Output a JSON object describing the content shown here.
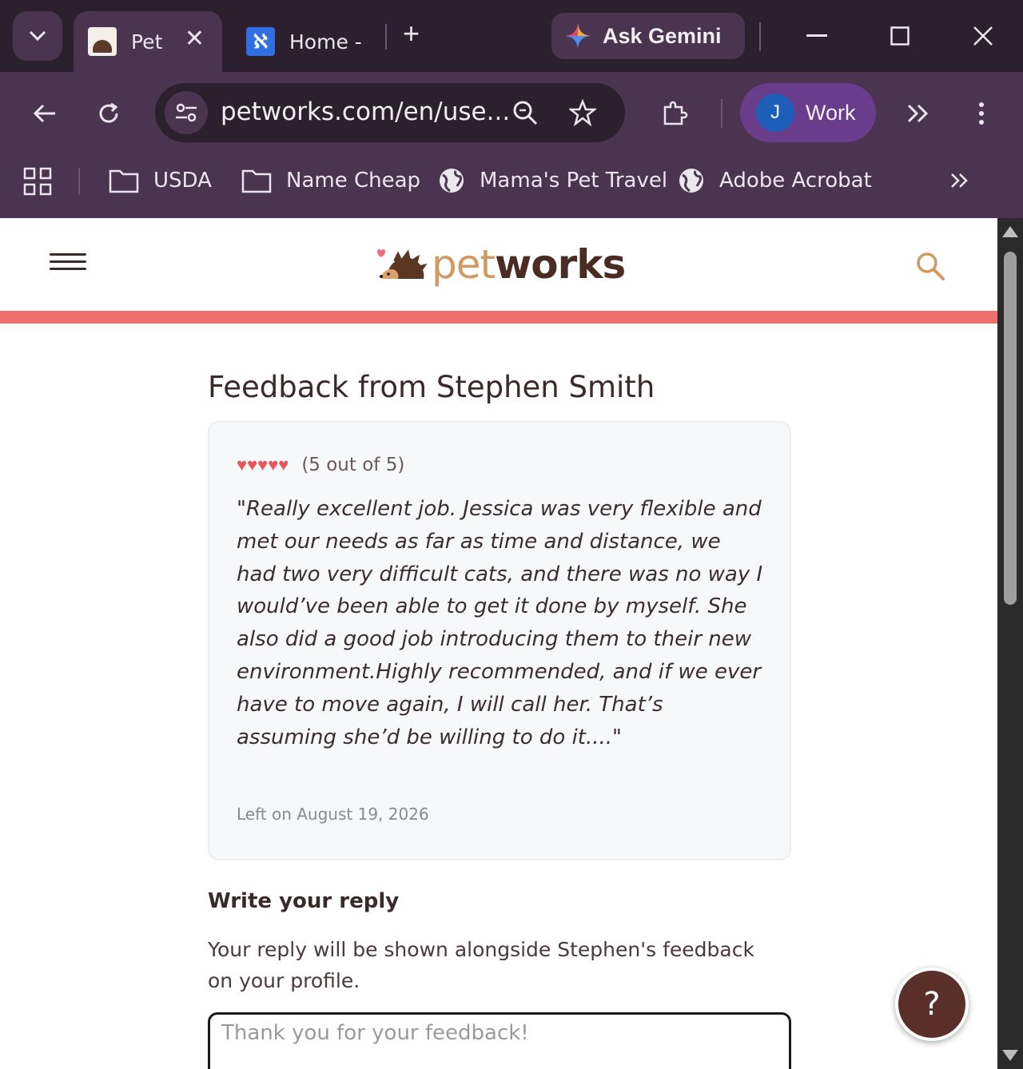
{
  "browser": {
    "tabs": [
      {
        "title": "Pet",
        "active": true,
        "icon": "petworks-favicon"
      },
      {
        "title": "Home -",
        "active": false,
        "icon": "home-app-favicon"
      }
    ],
    "gemini_label": "Ask Gemini",
    "url": "petworks.com/en/use...",
    "profile": {
      "initial": "J",
      "label": "Work"
    },
    "bookmarks": [
      {
        "label": "USDA",
        "icon": "folder-icon"
      },
      {
        "label": "Name Cheap",
        "icon": "folder-icon"
      },
      {
        "label": "Mama's Pet Travel",
        "icon": "globe-icon"
      },
      {
        "label": "Adobe Acrobat",
        "icon": "globe-icon"
      }
    ]
  },
  "site": {
    "logo_pet": "pet",
    "logo_works": "works"
  },
  "feedback": {
    "title": "Feedback from Stephen Smith",
    "hearts": "♥♥♥♥♥",
    "rating": 5,
    "rating_text": "(5 out of 5)",
    "quote": "\"Really excellent job. Jessica was very flexible and met our needs as far as time and distance, we had two very difficult cats, and there was no way I would’ve been able to get it done by myself. She also did a good job introducing them to their new environment.Highly recommended, and if we ever have to move again, I will call her. That’s assuming she’d be willing to do it....\"",
    "left_on": "Left on August 19, 2026"
  },
  "reply": {
    "heading": "Write your reply",
    "description": "Your reply will be shown alongside Stephen's feedback on your profile.",
    "placeholder": "Thank you for your feedback!",
    "value": ""
  },
  "help": {
    "label": "?"
  },
  "colors": {
    "accent_bar": "#f07070",
    "heart": "#e8565c",
    "logo_pet": "#d19a63",
    "logo_works": "#4a2c22",
    "help_button": "#5a2f2a",
    "chrome_bg": "#4a3450"
  }
}
